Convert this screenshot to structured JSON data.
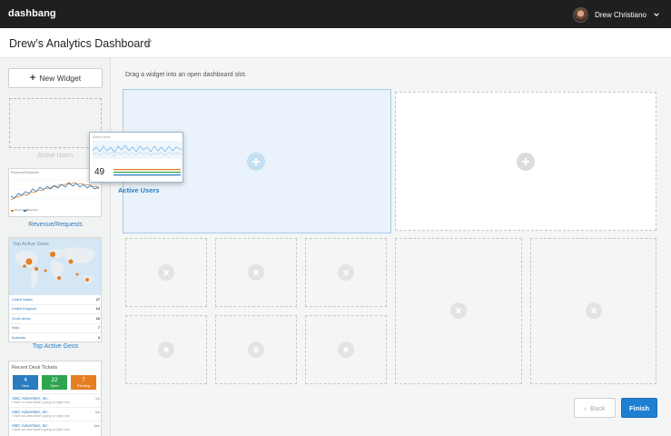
{
  "app": {
    "brand": "dashbang"
  },
  "user": {
    "name": "Drew Christiano",
    "avatar_icon": "user-avatar",
    "menu_icon": "chevron-down-icon"
  },
  "header": {
    "title": "Drew’s Analytics Dashboard",
    "edit_icon": "pencil-icon"
  },
  "sidebar": {
    "new_widget_label": "New Widget",
    "active_users_label": "Active Users",
    "revenue_label": "Revenue/Requests",
    "revenue_widget_title": "Revenue/Requests",
    "revenue_legend": [
      "Revenue ($)",
      "Requests"
    ],
    "geos_label": "Top Active Geos",
    "geos_widget_title": "Top Active Geos",
    "geos": [
      {
        "name": "United States",
        "value": "27"
      },
      {
        "name": "United Kingdom",
        "value": "14"
      },
      {
        "name": "South Africa",
        "value": "10"
      },
      {
        "name": "India",
        "value": "7"
      },
      {
        "name": "Australia",
        "value": "3"
      }
    ],
    "tickets": {
      "title": "Recent Desk Tickets",
      "counts": [
        {
          "num": "4",
          "label": "New",
          "color": "#2b7bc0"
        },
        {
          "num": "22",
          "label": "Open",
          "color": "#2ea44f"
        },
        {
          "num": "7",
          "label": "Pending",
          "color": "#e67e22"
        }
      ],
      "items": [
        {
          "company": "ABC Advertiser, Inc.",
          "message": "I have no idea what's going on right now",
          "ago": "1m"
        },
        {
          "company": "ABC Advertiser, Inc.",
          "message": "I have no idea what's going on right now",
          "ago": "5m"
        },
        {
          "company": "ABC Advertiser, Inc.",
          "message": "I have no idea what's going on right now",
          "ago": "16m"
        }
      ]
    }
  },
  "main": {
    "instruction": "Drag a widget into an open dashboard slot.",
    "drag_widget": {
      "title": "Active Users",
      "value": "49",
      "caption": "Active Users"
    },
    "back_label": "Back",
    "finish_label": "Finish"
  },
  "colors": {
    "accent": "#1f7fd2",
    "link": "#2b7bc0",
    "orange": "#e67e22",
    "topbar": "#1f1f1f"
  }
}
